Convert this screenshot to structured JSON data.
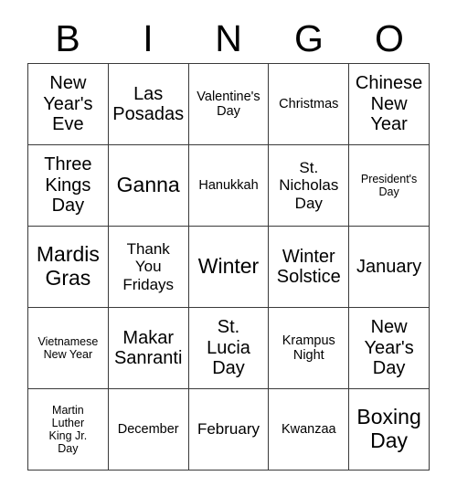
{
  "card": {
    "header_letters": [
      "B",
      "I",
      "N",
      "G",
      "O"
    ],
    "rows": [
      [
        {
          "label": "New\nYear's\nEve",
          "size": "lg"
        },
        {
          "label": "Las\nPosadas",
          "size": "lg"
        },
        {
          "label": "Valentine's\nDay",
          "size": "sm"
        },
        {
          "label": "Christmas",
          "size": "sm"
        },
        {
          "label": "Chinese\nNew\nYear",
          "size": "lg"
        }
      ],
      [
        {
          "label": "Three\nKings\nDay",
          "size": "lg"
        },
        {
          "label": "Ganna",
          "size": "xl"
        },
        {
          "label": "Hanukkah",
          "size": "sm"
        },
        {
          "label": "St.\nNicholas\nDay",
          "size": "md"
        },
        {
          "label": "President's\nDay",
          "size": "xs"
        }
      ],
      [
        {
          "label": "Mardis\nGras",
          "size": "xl"
        },
        {
          "label": "Thank\nYou\nFridays",
          "size": "md"
        },
        {
          "label": "Winter",
          "size": "xl"
        },
        {
          "label": "Winter\nSolstice",
          "size": "lg"
        },
        {
          "label": "January",
          "size": "lg"
        }
      ],
      [
        {
          "label": "Vietnamese\nNew Year",
          "size": "xs"
        },
        {
          "label": "Makar\nSanranti",
          "size": "lg"
        },
        {
          "label": "St.\nLucia\nDay",
          "size": "lg"
        },
        {
          "label": "Krampus\nNight",
          "size": "sm"
        },
        {
          "label": "New\nYear's\nDay",
          "size": "lg"
        }
      ],
      [
        {
          "label": "Martin\nLuther\nKing Jr.\nDay",
          "size": "xs"
        },
        {
          "label": "December",
          "size": "sm"
        },
        {
          "label": "February",
          "size": "md"
        },
        {
          "label": "Kwanzaa",
          "size": "sm"
        },
        {
          "label": "Boxing\nDay",
          "size": "xl"
        }
      ]
    ]
  }
}
